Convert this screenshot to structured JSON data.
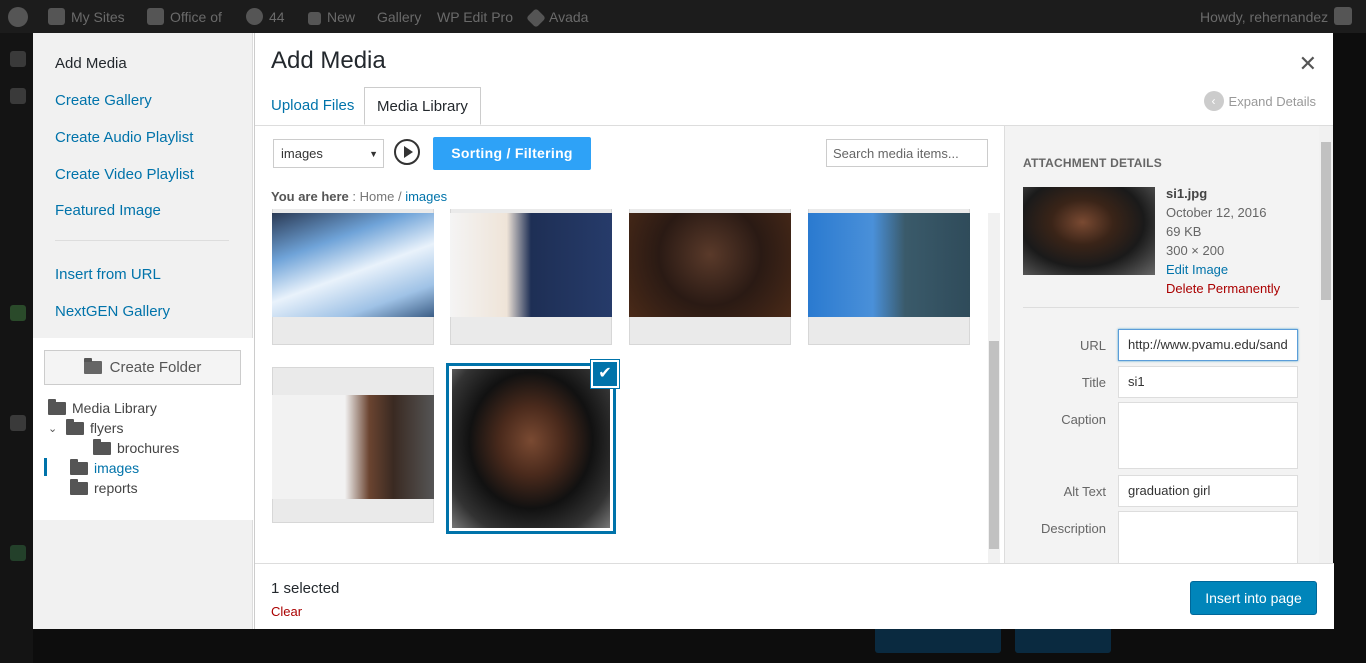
{
  "admin_bar": {
    "my_sites": "My Sites",
    "site_name": "Office of",
    "updates": "44",
    "new": "New",
    "gallery": "Gallery",
    "wp_edit_pro": "WP Edit Pro",
    "avada": "Avada",
    "howdy": "Howdy, rehernandez"
  },
  "sidebar": {
    "title": "Add Media",
    "links": [
      "Create Gallery",
      "Create Audio Playlist",
      "Create Video Playlist",
      "Featured Image"
    ],
    "links2": [
      "Insert from URL",
      "NextGEN Gallery"
    ],
    "create_folder": "Create Folder",
    "tree": {
      "root": "Media Library",
      "flyers": "flyers",
      "brochures": "brochures",
      "images": "images",
      "reports": "reports"
    }
  },
  "modal": {
    "title": "Add Media",
    "tabs": [
      "Upload Files",
      "Media Library"
    ],
    "expand_details": "Expand Details",
    "filter_value": "images",
    "sorting_button": "Sorting / Filtering",
    "search_placeholder": "Search media items...",
    "breadcrumb": {
      "label": "You are here",
      "home": "Home",
      "current": "images"
    }
  },
  "attachment": {
    "heading": "Attachment Details",
    "filename": "si1.jpg",
    "date": "October 12, 2016",
    "size": "69 KB",
    "dimensions": "300 × 200",
    "edit": "Edit Image",
    "delete": "Delete Permanently",
    "fields": {
      "url_label": "URL",
      "url_value": "http://www.pvamu.edu/sand",
      "title_label": "Title",
      "title_value": "si1",
      "caption_label": "Caption",
      "caption_value": "",
      "alt_label": "Alt Text",
      "alt_value": "graduation girl",
      "description_label": "Description",
      "description_value": ""
    }
  },
  "footer": {
    "selected": "1 selected",
    "clear": "Clear",
    "insert": "Insert into page"
  },
  "colors": {
    "accent": "#0073aa",
    "primary_button": "#0085ba",
    "sort_button": "#2ea2f7",
    "danger": "#a00"
  }
}
